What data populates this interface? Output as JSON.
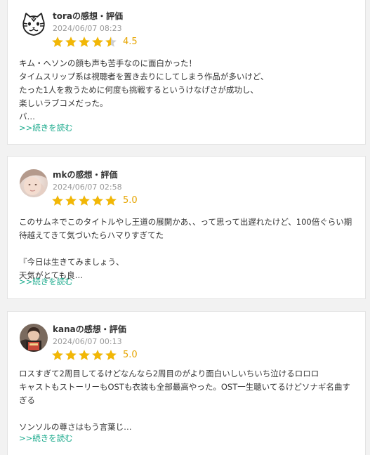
{
  "colors": {
    "star_filled": "#f2b705",
    "star_empty": "#cfcfcf",
    "score_text": "#e6a400",
    "link": "#1aaa8c",
    "date_text": "#9a9a9a"
  },
  "reviews": [
    {
      "username": "tora",
      "suffix": "の感想・評価",
      "date": "2024/06/07 08:23",
      "rating": 4.5,
      "score_label": "4.5",
      "avatar_icon": "tiger-face-icon",
      "lines": [
        "キム・ヘソンの顔も声も苦手なのに面白かった！",
        "タイムスリップ系は視聴者を置き去りにしてしまう作品が多いけど、",
        "たった1人を救うために何度も挑戦するというけなげさが成功し、",
        "楽しいラブコメだった。",
        "バ…"
      ],
      "more_label": ">>続きを読む"
    },
    {
      "username": "mk",
      "suffix": "の感想・評価",
      "date": "2024/06/07 02:58",
      "rating": 5.0,
      "score_label": "5.0",
      "avatar_icon": "user-photo-avatar",
      "lines": [
        "このサムネでこのタイトルやし王道の展開かあ、、って思って出遅れたけど、100倍ぐらい期",
        "待越えてきて気づいたらハマりすぎてた",
        "",
        "『今日は生きてみましょう、",
        "天気がとても良…"
      ],
      "more_label": ">>続きを読む"
    },
    {
      "username": "kana",
      "suffix": "の感想・評価",
      "date": "2024/06/07 00:13",
      "rating": 5.0,
      "score_label": "5.0",
      "avatar_icon": "user-photo-avatar",
      "lines": [
        "ロスすぎて2周目してるけどなんなら2周目のがより面白いしいちいち泣けるロロロ",
        "キャストもストーリーもOSTも衣装も全部最高やった。OST一生聴いてるけどソナギ名曲す",
        "ぎる",
        "",
        "ソンソルの尊さはもう言葉じ…"
      ],
      "more_label": ">>続きを読む"
    }
  ]
}
